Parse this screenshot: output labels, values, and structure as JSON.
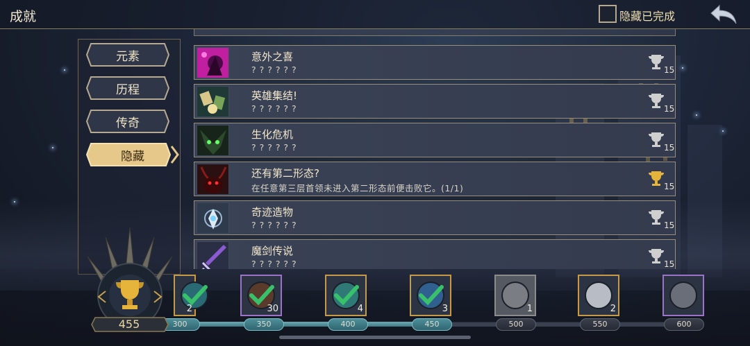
{
  "header": {
    "title": "成就",
    "hidden_completed_label": "隐藏已完成",
    "hidden_completed_checked": false
  },
  "categories": [
    {
      "label": "元素",
      "active": false
    },
    {
      "label": "历程",
      "active": false
    },
    {
      "label": "传奇",
      "active": false
    },
    {
      "label": "隐藏",
      "active": true
    }
  ],
  "achievements": [
    {
      "name": "意外之喜",
      "desc": "? ? ? ? ? ?",
      "points": "15",
      "completed": false,
      "icon": "pink-creature-icon"
    },
    {
      "name": "英雄集结!",
      "desc": "? ? ? ? ? ?",
      "points": "15",
      "completed": false,
      "icon": "hero-gathering-icon"
    },
    {
      "name": "生化危机",
      "desc": "? ? ? ? ? ?",
      "points": "15",
      "completed": false,
      "icon": "green-monster-icon"
    },
    {
      "name": "还有第二形态?",
      "desc": "在任意第三层首领未进入第二形态前便击败它。(1/1)",
      "points": "15",
      "completed": true,
      "icon": "horned-boss-icon"
    },
    {
      "name": "奇迹造物",
      "desc": "? ? ? ? ? ?",
      "points": "15",
      "completed": false,
      "icon": "crystal-artifact-icon"
    },
    {
      "name": "魔剑传说",
      "desc": "? ? ? ? ? ?",
      "points": "15",
      "completed": false,
      "icon": "magic-sword-icon"
    }
  ],
  "score": {
    "value": "455"
  },
  "progress": {
    "current": 455,
    "milestones": [
      "300",
      "350",
      "400",
      "450",
      "500",
      "550",
      "600"
    ]
  },
  "rewards": [
    {
      "count": "2",
      "claimed": true,
      "frame": "gold",
      "icon": "gem-icon"
    },
    {
      "count": "30",
      "claimed": true,
      "frame": "purple",
      "icon": "warrior-card-icon"
    },
    {
      "count": "4",
      "claimed": true,
      "frame": "gold",
      "icon": "teal-gem-icon"
    },
    {
      "count": "3",
      "claimed": true,
      "frame": "gold",
      "icon": "blue-gem-icon"
    },
    {
      "count": "1",
      "claimed": false,
      "frame": "gray",
      "icon": "locked-card-icon"
    },
    {
      "count": "2",
      "claimed": false,
      "frame": "gold",
      "icon": "silver-gem-icon"
    },
    {
      "count": "",
      "claimed": false,
      "frame": "purple",
      "icon": "knight-card-icon"
    }
  ],
  "colors": {
    "gold": "#c79a48",
    "accent_teal": "#4e8f99",
    "panel": "#3a4256",
    "check": "#38c06a"
  }
}
